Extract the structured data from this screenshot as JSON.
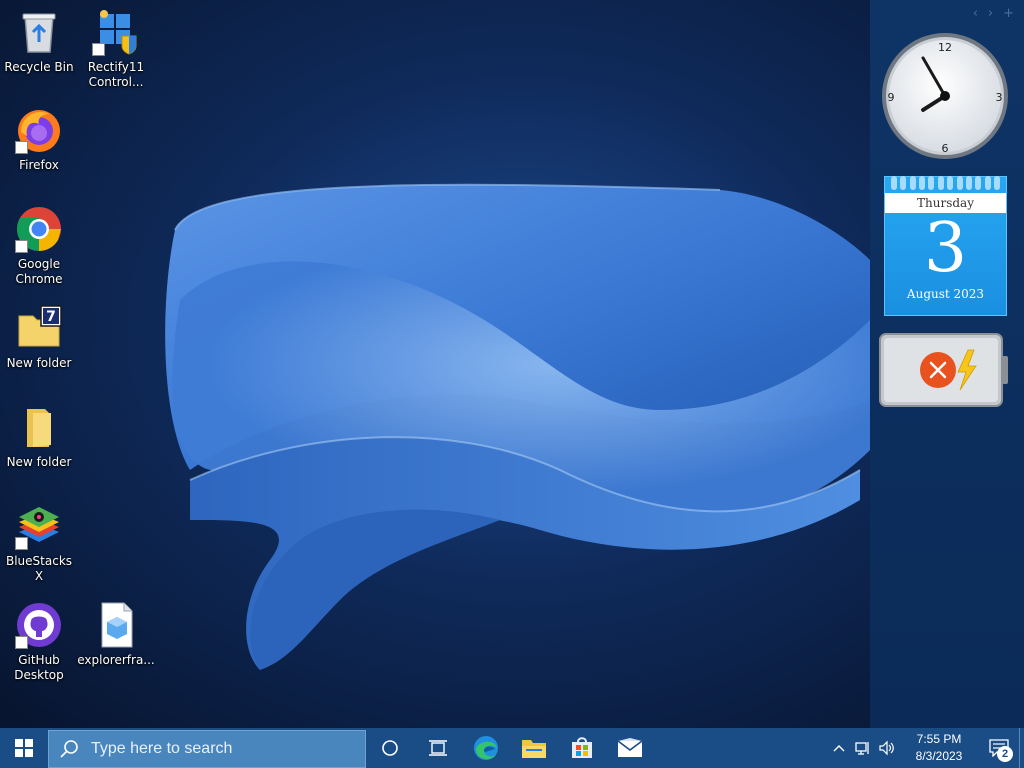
{
  "desktop": {
    "icons": [
      {
        "label": "Recycle Bin",
        "icon": "recycle-bin-icon"
      },
      {
        "label": "Rectify11\nControl...",
        "icon": "control-panel-icon"
      },
      {
        "label": "Firefox",
        "icon": "firefox-icon"
      },
      {
        "label": "Google\nChrome",
        "icon": "chrome-icon"
      },
      {
        "label": "New folder",
        "icon": "folder-7zip-icon"
      },
      {
        "label": "New folder",
        "icon": "folder-icon"
      },
      {
        "label": "BlueStacks X",
        "icon": "bluestacks-icon"
      },
      {
        "label": "GitHub\nDesktop",
        "icon": "github-icon"
      },
      {
        "label": "explorerfra...",
        "icon": "file-icon"
      }
    ]
  },
  "sidebar": {
    "nav": [
      "‹",
      "›",
      "+"
    ],
    "clock": {
      "numbers": [
        "12",
        "3",
        "6",
        "9"
      ],
      "hour": 7,
      "minute": 55
    },
    "calendar": {
      "weekday": "Thursday",
      "day": "3",
      "month_year": "August 2023"
    },
    "battery": {
      "status_icon": "battery-error-icon",
      "charging_icon": "lightning-icon"
    }
  },
  "taskbar": {
    "start_icon": "windows-logo-icon",
    "search_placeholder": "Type here to search",
    "pinned": [
      "cortana-icon",
      "task-view-icon",
      "edge-icon",
      "file-explorer-icon",
      "store-icon",
      "mail-icon"
    ],
    "tray": {
      "time": "7:55 PM",
      "date": "8/3/2023",
      "notification_count": "2"
    }
  },
  "colors": {
    "taskbar": "#1a4c86",
    "sidebar": "#0e3466",
    "calendar": "#1a8fe0",
    "wallpaper_accent": "#3d7ad6"
  }
}
